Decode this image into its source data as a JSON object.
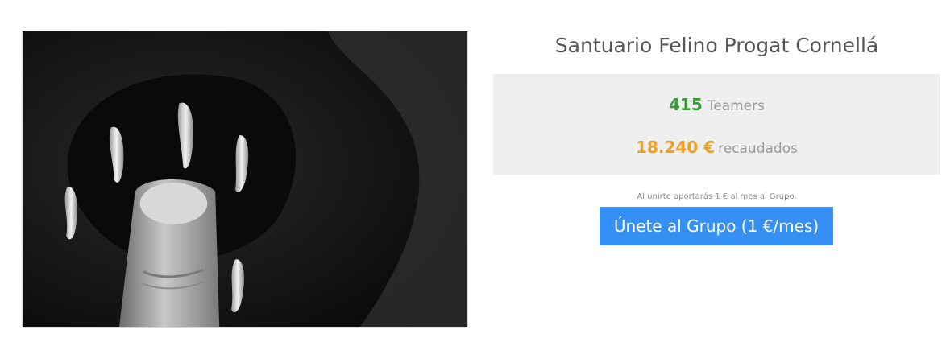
{
  "group": {
    "name": "Santuario Felino Progat Cornellá",
    "photo_icon": "cat-paw-photo"
  },
  "stats": {
    "teamers_count": "415",
    "teamers_label": "Teamers",
    "raised_amount": "18.240 €",
    "raised_label": "recaudados"
  },
  "join": {
    "note": "Al unirte aportarás 1 € al mes al Grupo.",
    "button_label": "Únete al Grupo (1 €/mes)"
  },
  "colors": {
    "accent_green": "#3a9a3a",
    "accent_orange": "#f0a020",
    "button_blue": "#3490f2",
    "panel_gray": "#efefef"
  }
}
